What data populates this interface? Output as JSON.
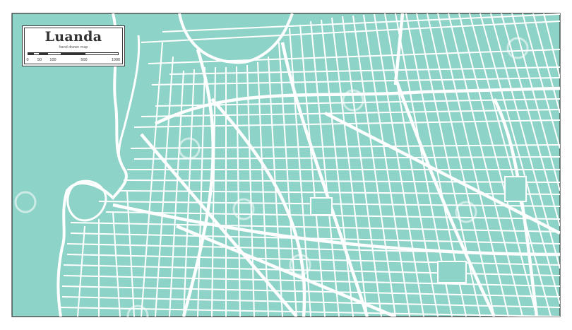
{
  "map": {
    "title": "Luanda",
    "subtitle": "hand drawn map",
    "colors": {
      "water": "#8ed3c7",
      "land": "#8ed3c7",
      "streets": "#ffffff",
      "frame": "#2e2e2e",
      "label_box": "#ffffff"
    },
    "scale": {
      "labels": [
        "0",
        "50",
        "100",
        "500",
        "1000"
      ]
    }
  }
}
